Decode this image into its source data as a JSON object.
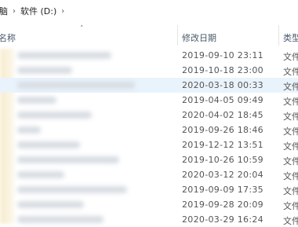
{
  "breadcrumb": {
    "parent": "脑",
    "drive": "软件 (D:)"
  },
  "columns": {
    "name": "名称",
    "date": "修改日期",
    "type": "类型"
  },
  "rows": [
    {
      "date": "2019-09-10 23:11",
      "type": "文件"
    },
    {
      "date": "2019-10-18 23:00",
      "type": "文件"
    },
    {
      "date": "2020-03-18 00:33",
      "type": "文件",
      "selected": true
    },
    {
      "date": "2019-04-05 09:49",
      "type": "文件"
    },
    {
      "date": "2020-04-02 18:45",
      "type": "文件"
    },
    {
      "date": "2019-09-26 18:46",
      "type": "文件"
    },
    {
      "date": "2019-12-12 13:51",
      "type": "文件"
    },
    {
      "date": "2019-10-26 10:59",
      "type": "文件"
    },
    {
      "date": "2020-03-12 20:04",
      "type": "文件"
    },
    {
      "date": "2019-09-09 17:35",
      "type": "文件"
    },
    {
      "date": "2019-09-28 20:09",
      "type": "文件"
    },
    {
      "date": "2020-03-29 16:24",
      "type": "文件"
    }
  ],
  "colors": {
    "selected_row": "#e9f3fc",
    "header_text": "#4a5a6b",
    "folder_tint": "#f7ecd0"
  },
  "icons": {
    "sort": "sort-ascending-icon",
    "separator": "chevron-right-icon"
  }
}
